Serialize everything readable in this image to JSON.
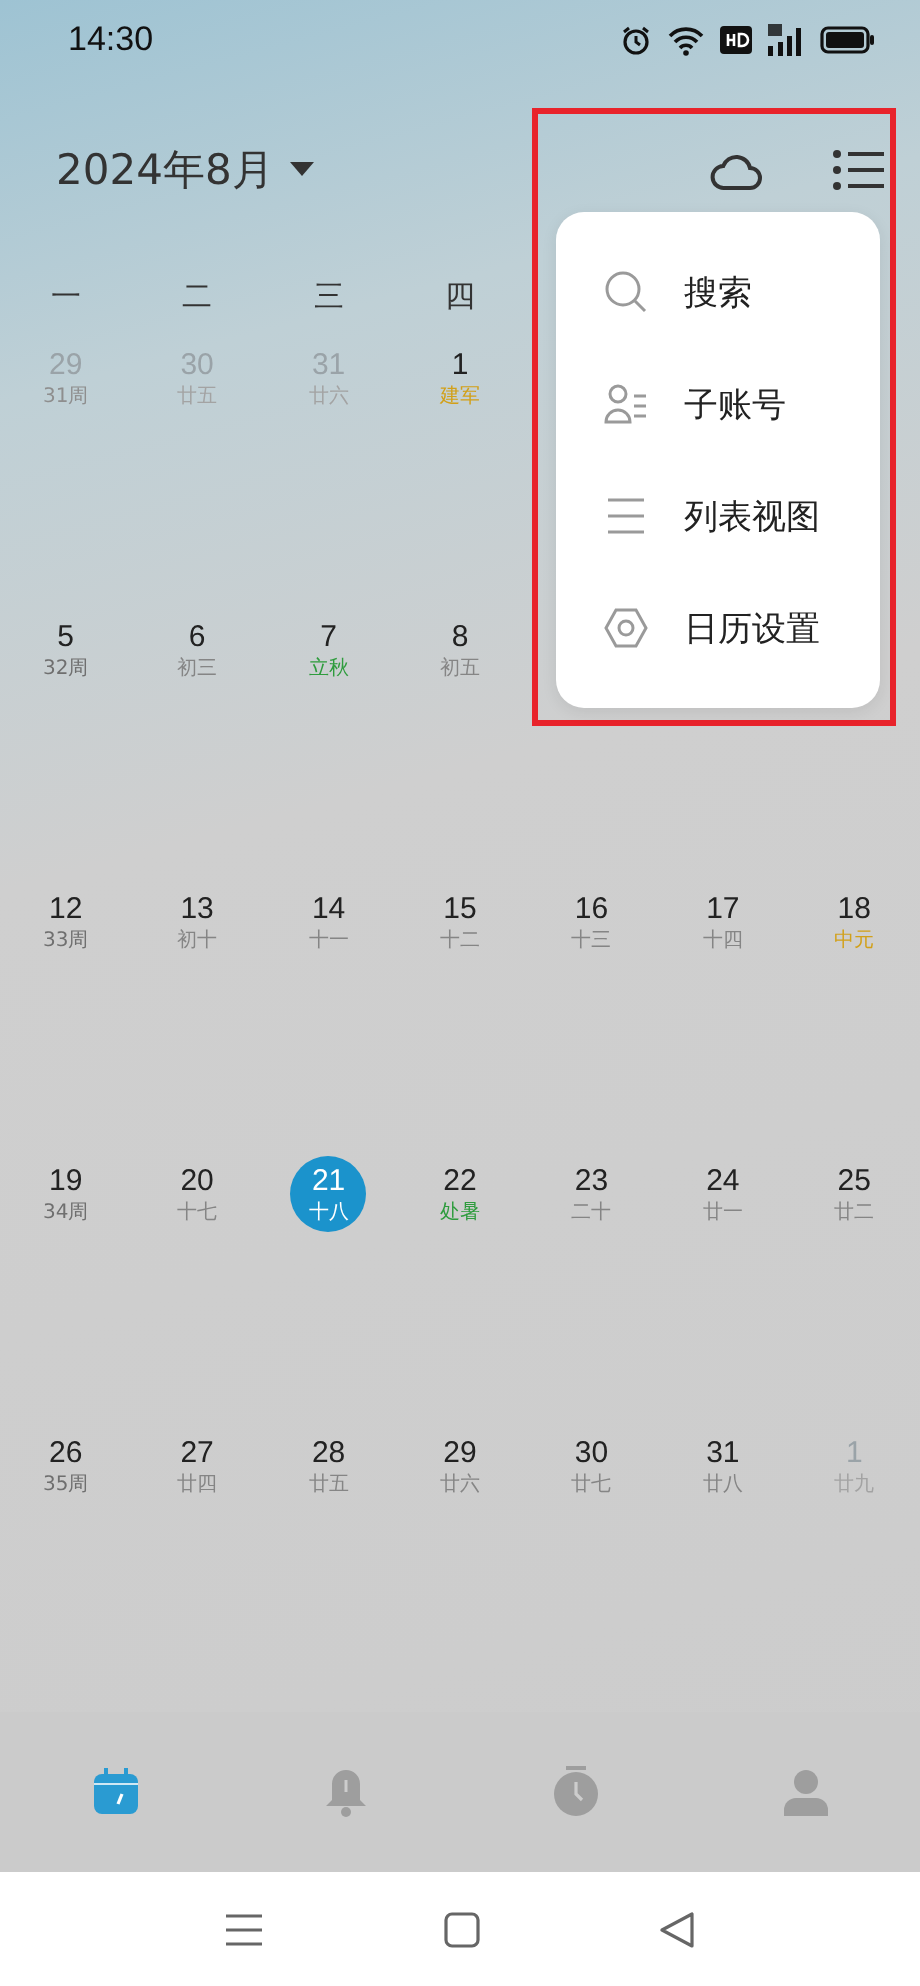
{
  "status_bar": {
    "time": "14:30"
  },
  "header": {
    "month": "2024年8月"
  },
  "weekdays": [
    "一",
    "二",
    "三",
    "四"
  ],
  "weeks": [
    {
      "days": [
        {
          "date": "29",
          "sub": "31周",
          "kind": "other-month",
          "color": "#8e8e8e",
          "selected": false
        },
        {
          "date": "30",
          "sub": "廿五",
          "kind": "other-month",
          "color": "#a3a3a3",
          "selected": false
        },
        {
          "date": "31",
          "sub": "廿六",
          "kind": "other-month",
          "color": "#a3a3a3",
          "selected": false
        },
        {
          "date": "1",
          "sub": "建军",
          "kind": "current",
          "color": "#d2a019",
          "selected": false
        }
      ]
    },
    {
      "days": [
        {
          "date": "5",
          "sub": "32周",
          "kind": "current",
          "color": "#6f6f6f",
          "selected": false
        },
        {
          "date": "6",
          "sub": "初三",
          "kind": "current",
          "color": "#858585",
          "selected": false
        },
        {
          "date": "7",
          "sub": "立秋",
          "kind": "current",
          "color": "#2e9c3d",
          "selected": false
        },
        {
          "date": "8",
          "sub": "初五",
          "kind": "current",
          "color": "#858585",
          "selected": false
        }
      ]
    },
    {
      "days": [
        {
          "date": "12",
          "sub": "33周",
          "kind": "current",
          "color": "#6f6f6f",
          "selected": false
        },
        {
          "date": "13",
          "sub": "初十",
          "kind": "current",
          "color": "#858585",
          "selected": false
        },
        {
          "date": "14",
          "sub": "十一",
          "kind": "current",
          "color": "#858585",
          "selected": false
        },
        {
          "date": "15",
          "sub": "十二",
          "kind": "current",
          "color": "#858585",
          "selected": false
        },
        {
          "date": "16",
          "sub": "十三",
          "kind": "current",
          "color": "#858585",
          "selected": false
        },
        {
          "date": "17",
          "sub": "十四",
          "kind": "current",
          "color": "#858585",
          "selected": false
        },
        {
          "date": "18",
          "sub": "中元",
          "kind": "current",
          "color": "#d2a019",
          "selected": false
        }
      ]
    },
    {
      "days": [
        {
          "date": "19",
          "sub": "34周",
          "kind": "current",
          "color": "#6f6f6f",
          "selected": false
        },
        {
          "date": "20",
          "sub": "十七",
          "kind": "current",
          "color": "#858585",
          "selected": false
        },
        {
          "date": "21",
          "sub": "十八",
          "kind": "current",
          "color": "#ffffff",
          "selected": true
        },
        {
          "date": "22",
          "sub": "处暑",
          "kind": "current",
          "color": "#2e9c3d",
          "selected": false
        },
        {
          "date": "23",
          "sub": "二十",
          "kind": "current",
          "color": "#858585",
          "selected": false
        },
        {
          "date": "24",
          "sub": "廿一",
          "kind": "current",
          "color": "#858585",
          "selected": false
        },
        {
          "date": "25",
          "sub": "廿二",
          "kind": "current",
          "color": "#858585",
          "selected": false
        }
      ]
    },
    {
      "days": [
        {
          "date": "26",
          "sub": "35周",
          "kind": "current",
          "color": "#6f6f6f",
          "selected": false
        },
        {
          "date": "27",
          "sub": "廿四",
          "kind": "current",
          "color": "#858585",
          "selected": false
        },
        {
          "date": "28",
          "sub": "廿五",
          "kind": "current",
          "color": "#858585",
          "selected": false
        },
        {
          "date": "29",
          "sub": "廿六",
          "kind": "current",
          "color": "#858585",
          "selected": false
        },
        {
          "date": "30",
          "sub": "廿七",
          "kind": "current",
          "color": "#858585",
          "selected": false
        },
        {
          "date": "31",
          "sub": "廿八",
          "kind": "current",
          "color": "#858585",
          "selected": false
        },
        {
          "date": "1",
          "sub": "廿九",
          "kind": "other-month",
          "color": "#a3a3a3",
          "selected": false
        }
      ]
    }
  ],
  "menu": {
    "items": [
      {
        "label": "搜索",
        "kind": "search"
      },
      {
        "label": "子账号",
        "kind": "account"
      },
      {
        "label": "列表视图",
        "kind": "list"
      },
      {
        "label": "日历设置",
        "kind": "settings"
      }
    ]
  },
  "tab_bar": {
    "tabs": [
      {
        "kind": "calendar",
        "selected": true
      },
      {
        "kind": "bell",
        "selected": false
      },
      {
        "kind": "timer",
        "selected": false
      },
      {
        "kind": "person",
        "selected": false
      }
    ]
  }
}
